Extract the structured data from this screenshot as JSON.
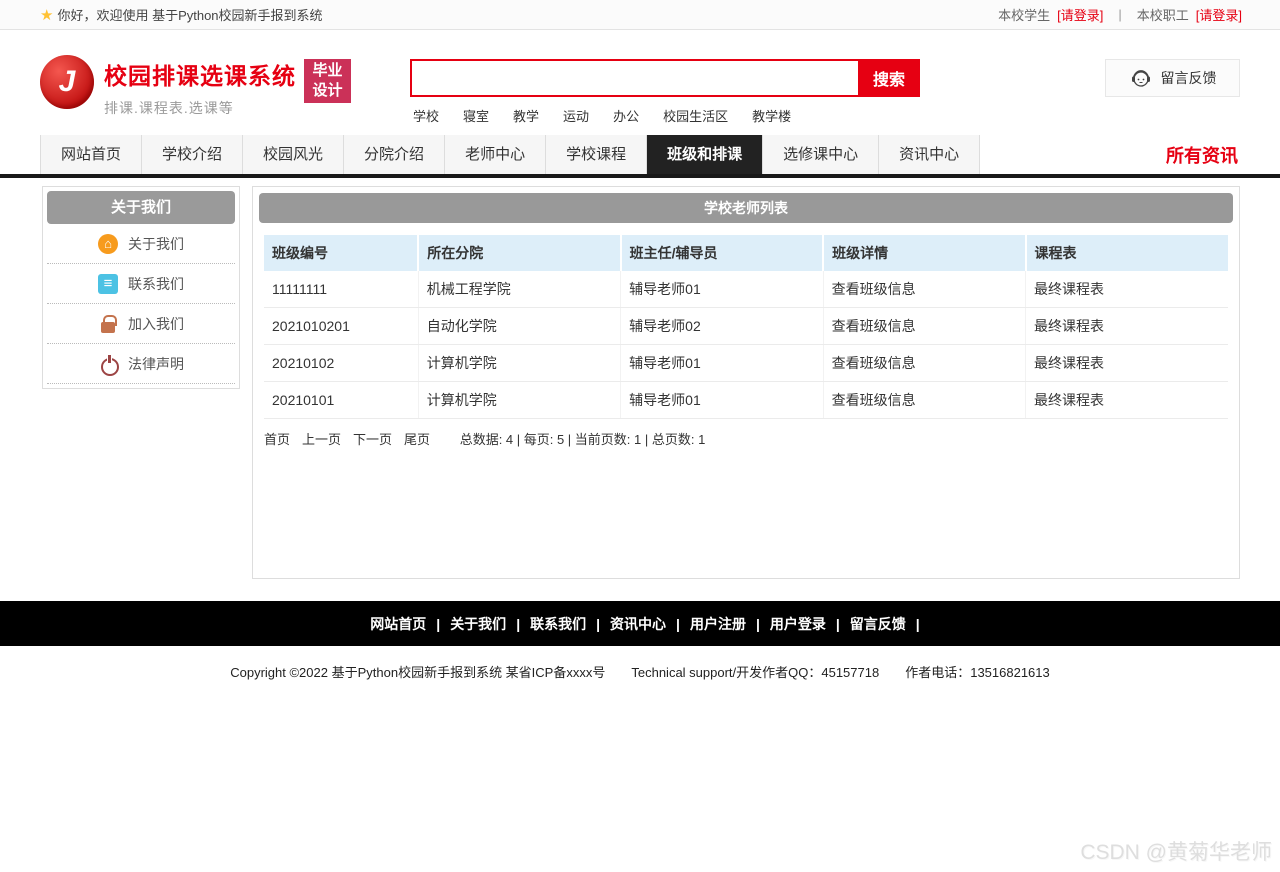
{
  "topbar": {
    "star_icon": "★",
    "welcome": "你好，欢迎使用 基于Python校园新手报到系统",
    "student_label": "本校学生",
    "student_login": "[请登录]",
    "divider": "|",
    "staff_label": "本校职工",
    "staff_login": "[请登录]"
  },
  "header": {
    "logo_letter": "J",
    "site_title": "校园排课选课系统",
    "site_subtitle": "排课.课程表.选课等",
    "badge_line1": "毕业",
    "badge_line2": "设计",
    "search_value": "",
    "search_button": "搜索",
    "hot_words": [
      "学校",
      "寝室",
      "教学",
      "运动",
      "办公",
      "校园生活区",
      "教学楼"
    ],
    "feedback_button": "留言反馈"
  },
  "nav": {
    "items": [
      {
        "label": "网站首页",
        "active": false
      },
      {
        "label": "学校介绍",
        "active": false
      },
      {
        "label": "校园风光",
        "active": false
      },
      {
        "label": "分院介绍",
        "active": false
      },
      {
        "label": "老师中心",
        "active": false
      },
      {
        "label": "学校课程",
        "active": false
      },
      {
        "label": "班级和排课",
        "active": true
      },
      {
        "label": "选修课中心",
        "active": false
      },
      {
        "label": "资讯中心",
        "active": false
      }
    ],
    "all_news": "所有资讯"
  },
  "sidebar": {
    "title": "关于我们",
    "items": [
      {
        "label": "关于我们",
        "icon": "home-icon"
      },
      {
        "label": "联系我们",
        "icon": "clipboard-icon"
      },
      {
        "label": "加入我们",
        "icon": "lock-icon"
      },
      {
        "label": "法律声明",
        "icon": "power-icon"
      }
    ]
  },
  "main": {
    "panel_title": "学校老师列表",
    "table": {
      "headers": [
        "班级编号",
        "所在分院",
        "班主任/辅导员",
        "班级详情",
        "课程表"
      ],
      "rows": [
        [
          "11111111",
          "机械工程学院",
          "辅导老师01",
          "查看班级信息",
          "最终课程表"
        ],
        [
          "2021010201",
          "自动化学院",
          "辅导老师02",
          "查看班级信息",
          "最终课程表"
        ],
        [
          "20210102",
          "计算机学院",
          "辅导老师01",
          "查看班级信息",
          "最终课程表"
        ],
        [
          "20210101",
          "计算机学院",
          "辅导老师01",
          "查看班级信息",
          "最终课程表"
        ]
      ]
    },
    "pagination": {
      "links": [
        "首页",
        "上一页",
        "下一页",
        "尾页"
      ],
      "stats_text": "总数据: 4 | 每页: 5 | 当前页数: 1 | 总页数: 1",
      "total": 4,
      "per_page": 5,
      "current_page": 1,
      "total_pages": 1
    }
  },
  "footer": {
    "links": [
      "网站首页",
      "关于我们",
      "联系我们",
      "资讯中心",
      "用户注册",
      "用户登录",
      "留言反馈"
    ],
    "separator": "|",
    "copyright": "Copyright ©2022 基于Python校园新手报到系统 某省ICP备xxxx号",
    "support": "Technical support/开发作者QQ：45157718",
    "phone": "作者电话：13516821613"
  },
  "watermark": "CSDN @黄菊华老师",
  "colors": {
    "accent_red": "#e60012",
    "badge_red": "#cb3158",
    "panel_gray": "#999999",
    "table_header_blue": "#ddeef9",
    "nav_active": "#222222",
    "footer_black": "#000000"
  }
}
